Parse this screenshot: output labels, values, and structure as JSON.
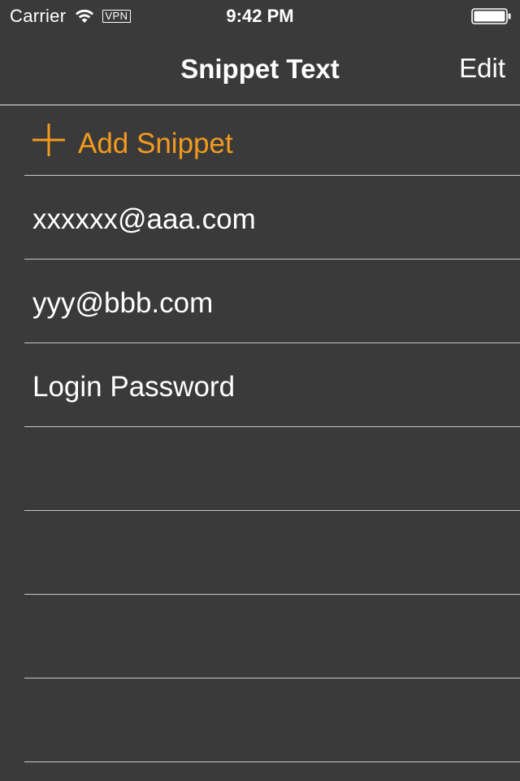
{
  "status_bar": {
    "carrier": "Carrier",
    "wifi_icon": "wifi-icon",
    "vpn": "VPN",
    "time": "9:42 PM",
    "battery_icon": "battery-full-icon"
  },
  "nav_bar": {
    "title": "Snippet Text",
    "edit_label": "Edit"
  },
  "list": {
    "add_label": "Add Snippet",
    "add_icon": "plus-icon",
    "accent_color": "#f39a1e",
    "items": [
      {
        "label": "xxxxxx@aaa.com"
      },
      {
        "label": "yyy@bbb.com"
      },
      {
        "label": "Login Password"
      },
      {
        "label": ""
      },
      {
        "label": ""
      },
      {
        "label": ""
      },
      {
        "label": ""
      }
    ]
  },
  "colors": {
    "background": "#3a3a3a",
    "separator": "#c8c8c8",
    "text": "#ffffff"
  }
}
